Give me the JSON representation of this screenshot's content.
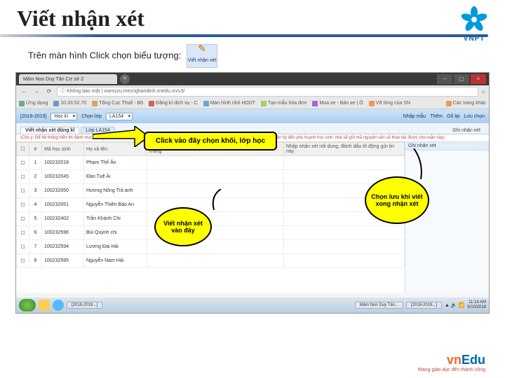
{
  "slide": {
    "title": "Viết nhận xét",
    "instruction_text": "Trên màn hình Click chọn biểu tượng:",
    "icon_caption": "Viết nhận xét"
  },
  "vnpt": {
    "brand": "VNPT"
  },
  "browser": {
    "tab_title": "Mầm Non Duy Tân Cơ sở 2",
    "url_warning": "Không bảo mật",
    "url": "voeszzu.mezoghandinh.vnedu.vn/v3/",
    "bookmarks": [
      "Ứng dụng",
      "10.33.52.70",
      "Tổng Cục Thuế - Bộ",
      "Đăng kí dịch vụ - C",
      "Màn hình nhỏ HDDT",
      "Tạo mẫu hóa đơn",
      "Mua xe - Bán xe | Ô",
      "Vỡ lòng của SN",
      "Các trang khác"
    ]
  },
  "app": {
    "year_label": "[2018-2019]",
    "menu_items": [
      "Học kì",
      "Chọn lớp"
    ],
    "class_value": "LA154",
    "right_tools": [
      "Nhập mẫu",
      "Thêm",
      "Gõ lại",
      "Lưu chọn"
    ],
    "sub_tabs": [
      "Viết nhận xét dũng kĩ",
      "Lớp  LA154"
    ],
    "sub_tab2_label": "Ghi nhận xét",
    "note_text": "(Chú ý: Để hệ thống hiển thị đánh mục thông báo mới nhất xin thông báo với Sở/ban/nhà, Nội dung nhập vào sẽ được gửi làm tin nhắn điện kỳ đến phụ huynh học sinh, nhà sẽ gửi mã nguyên văn sẽ thao tác được cho tuần này)",
    "columns": [
      "",
      "#",
      "Mã học sinh",
      "Họ và tên",
      "Nhập nhận xét chung, cùng nội dung gửi tin nhắn hàng tháng",
      "Nhập nhận xét nội dung, đánh dấu tô động gửi tin này"
    ],
    "rows": [
      {
        "idx": "1",
        "code": "100232018",
        "name": "Phạm Thế Ân"
      },
      {
        "idx": "2",
        "code": "100232045",
        "name": "Đào Tuệ Ái"
      },
      {
        "idx": "3",
        "code": "100232050",
        "name": "Hương Nông Trà anh"
      },
      {
        "idx": "4",
        "code": "100232051",
        "name": "Nguyễn Thiên Bảo An"
      },
      {
        "idx": "5",
        "code": "100232402",
        "name": "Trần Khánh Chi"
      },
      {
        "idx": "6",
        "code": "100232596",
        "name": "Bùi Quỳnh chi"
      },
      {
        "idx": "7",
        "code": "100232594",
        "name": "Lương Đại Hải"
      },
      {
        "idx": "8",
        "code": "100232595",
        "name": "Nguyễn Nam Hải"
      }
    ],
    "right_panel_header": "Ghi nhận xét"
  },
  "callouts": {
    "c1": "Click vào đây chọn khối, lớp học",
    "c2": "Viết nhận xét vào đây",
    "c3": "Chọn lưu khi viết xong nhận xét"
  },
  "taskbar": {
    "items": [
      "[2018-2019...]",
      "Mầm Non Duy Tân...",
      "[2018-2019...]"
    ],
    "time": "11:14 AM",
    "date": "5/10/2018"
  },
  "vnedu": {
    "brand_vn": "vn",
    "brand_edu": "Edu",
    "tagline": "Mang giáo dục đến thành công"
  }
}
